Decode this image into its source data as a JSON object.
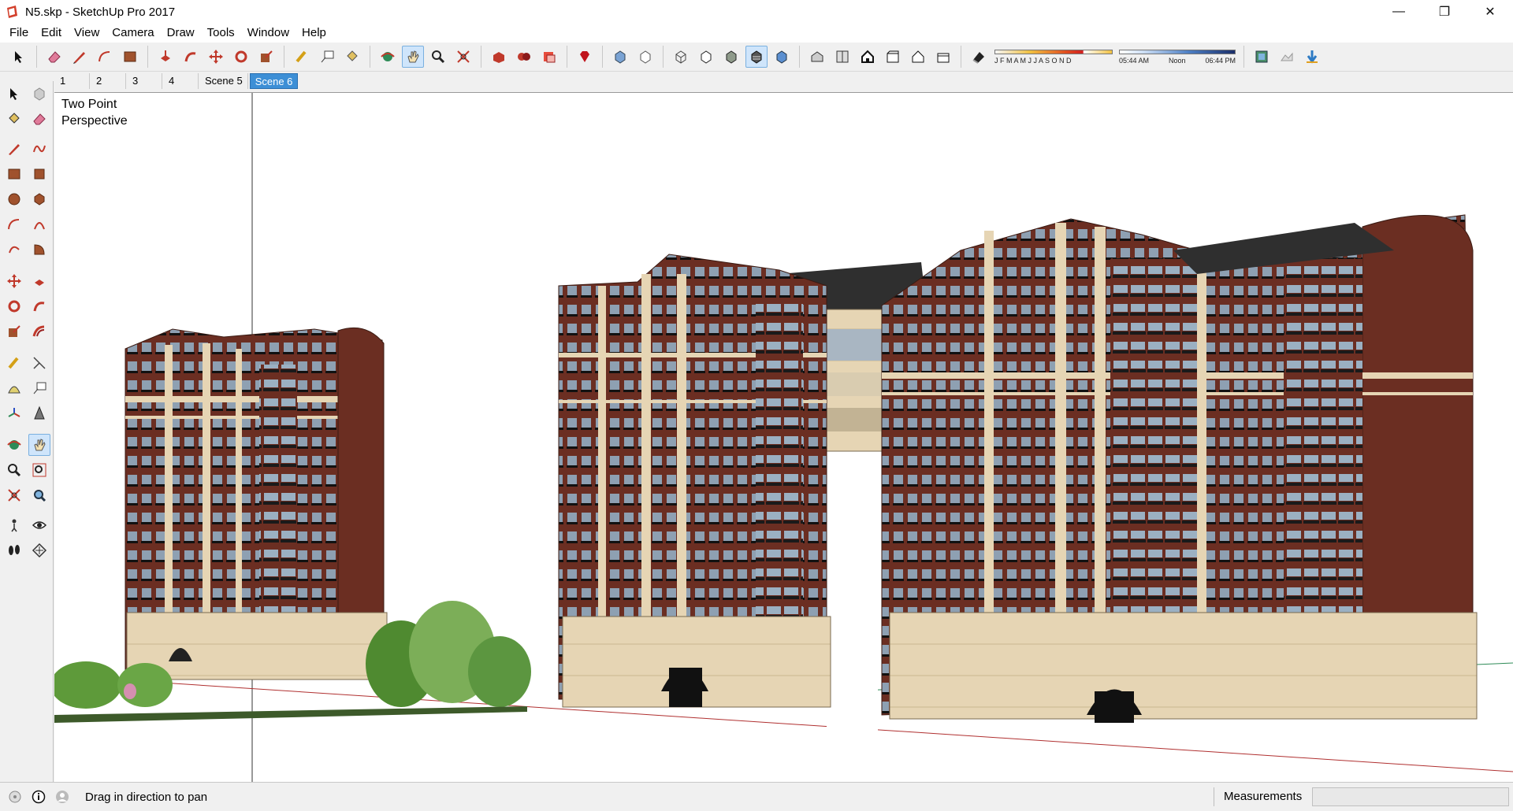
{
  "window": {
    "title": "N5.skp - SketchUp Pro 2017",
    "minimize_glyph": "—",
    "restore_glyph": "❐",
    "close_glyph": "✕"
  },
  "menu": [
    "File",
    "Edit",
    "View",
    "Camera",
    "Draw",
    "Tools",
    "Window",
    "Help"
  ],
  "toolbar": {
    "shadow_months": "J F M A M J J A S O N D",
    "shadow_time_start": "05:44 AM",
    "shadow_time_mid": "Noon",
    "shadow_time_end": "06:44 PM",
    "accent_color": "#3d8fd6"
  },
  "scenes": {
    "tabs": [
      "1",
      "2",
      "3",
      "4",
      "Scene 5",
      "Scene 6"
    ],
    "active": "Scene 6"
  },
  "viewport": {
    "camera_label_line1": "Two Point",
    "camera_label_line2": "Perspective",
    "brick_color": "#6b2e22",
    "stone_color": "#e6d5b4"
  },
  "status": {
    "message": "Drag in direction to pan",
    "measurements_label": "Measurements",
    "measurements_value": ""
  }
}
